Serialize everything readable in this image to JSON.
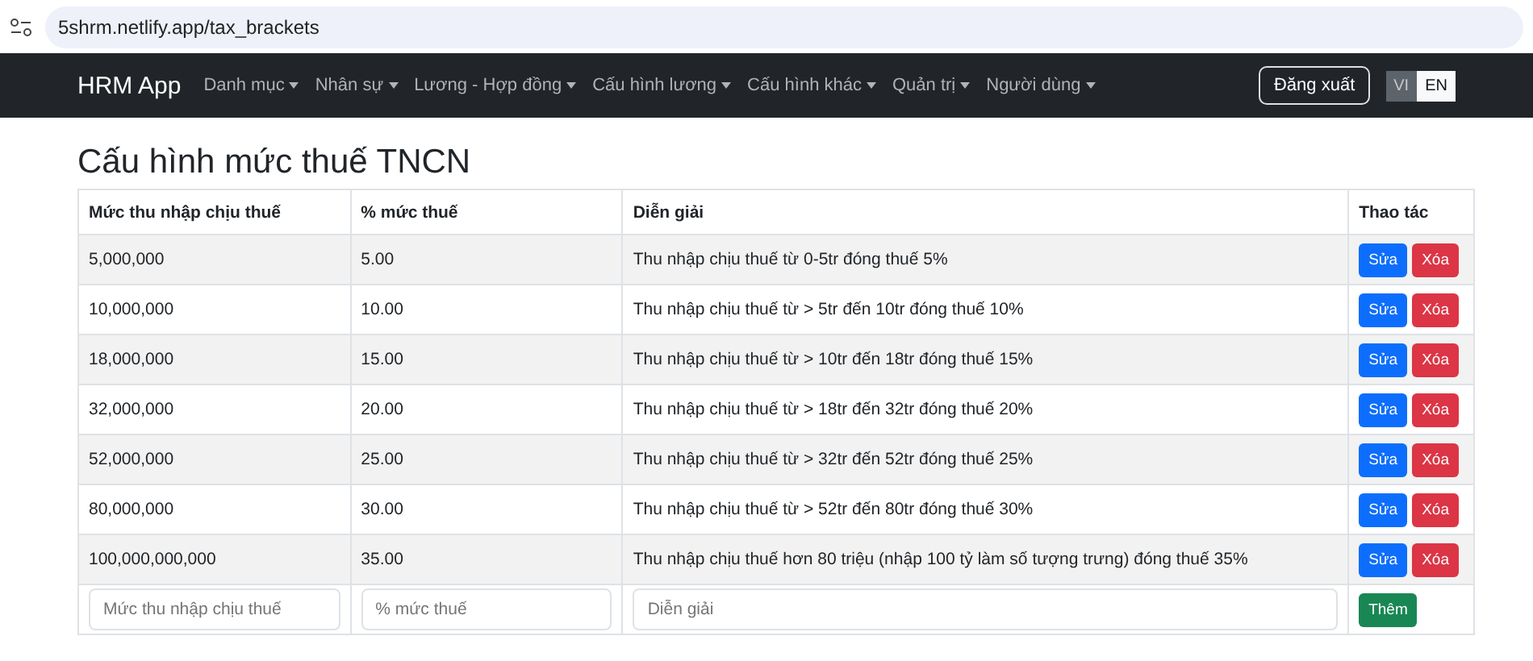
{
  "browser": {
    "url": "5shrm.netlify.app/tax_brackets"
  },
  "navbar": {
    "brand": "HRM App",
    "menus": [
      "Danh mục",
      "Nhân sự",
      "Lương - Hợp đồng",
      "Cấu hình lương",
      "Cấu hình khác",
      "Quản trị",
      "Người dùng"
    ],
    "logout": "Đăng xuất",
    "languages": [
      {
        "label": "VI",
        "selected": false
      },
      {
        "label": "EN",
        "selected": true
      }
    ]
  },
  "title": "Cấu hình mức thuế TNCN",
  "table": {
    "columns": [
      "Mức thu nhập chịu thuế",
      "% mức thuế",
      "Diễn giải",
      "Thao tác"
    ],
    "rows": [
      {
        "income": "5,000,000",
        "rate": "5.00",
        "description": "Thu nhập chịu thuế từ 0-5tr đóng thuế 5%",
        "edit": "Sửa",
        "delete": "Xóa"
      },
      {
        "income": "10,000,000",
        "rate": "10.00",
        "description": "Thu nhập chịu thuế từ > 5tr đến 10tr đóng thuế 10%",
        "edit": "Sửa",
        "delete": "Xóa"
      },
      {
        "income": "18,000,000",
        "rate": "15.00",
        "description": "Thu nhập chịu thuế từ > 10tr đến 18tr đóng thuế 15%",
        "edit": "Sửa",
        "delete": "Xóa"
      },
      {
        "income": "32,000,000",
        "rate": "20.00",
        "description": "Thu nhập chịu thuế từ > 18tr đến 32tr đóng thuế 20%",
        "edit": "Sửa",
        "delete": "Xóa"
      },
      {
        "income": "52,000,000",
        "rate": "25.00",
        "description": "Thu nhập chịu thuế từ > 32tr đến 52tr đóng thuế 25%",
        "edit": "Sửa",
        "delete": "Xóa"
      },
      {
        "income": "80,000,000",
        "rate": "30.00",
        "description": "Thu nhập chịu thuế từ > 52tr đến 80tr đóng thuế 30%",
        "edit": "Sửa",
        "delete": "Xóa"
      },
      {
        "income": "100,000,000,000",
        "rate": "35.00",
        "description": "Thu nhập chịu thuế hơn 80 triệu (nhập 100 tỷ làm số tượng trưng) đóng thuế 35%",
        "edit": "Sửa",
        "delete": "Xóa"
      }
    ],
    "new_row": {
      "income_placeholder": "Mức thu nhập chịu thuế",
      "rate_placeholder": "% mức thuế",
      "description_placeholder": "Diễn giải",
      "add": "Thêm"
    }
  }
}
